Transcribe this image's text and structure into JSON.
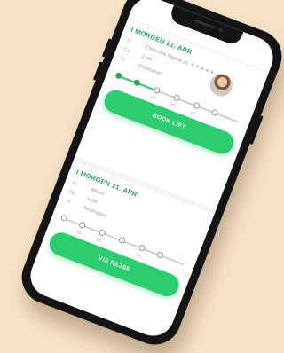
{
  "colors": {
    "background": "#f8e3c7",
    "accent": "#2ecc71",
    "accent_text": "#2ea45c"
  },
  "app": {
    "title": ""
  },
  "rides": [
    {
      "date": "I MORGEN 21. APR",
      "rows": [
        {
          "label": "Kl.",
          "value": "Cheomlee Nguele 21"
        },
        {
          "label": "Ca.",
          "value": "2 stk"
        },
        {
          "label": "Til",
          "value": "Destination"
        }
      ],
      "rating": "★★★★★",
      "avatar_icon": "user-avatar",
      "progress": 0.35,
      "stops": 6,
      "button": "BOOK LIFT"
    },
    {
      "date": "I MORGEN 21. APR",
      "rows": [
        {
          "label": "Kl.",
          "value": "Afhent"
        },
        {
          "label": "Ca.",
          "value": "2 stk"
        },
        {
          "label": "Til",
          "value": "Destination"
        }
      ],
      "progress": 0.0,
      "stops": 6,
      "button": "VIS REJSE"
    }
  ]
}
